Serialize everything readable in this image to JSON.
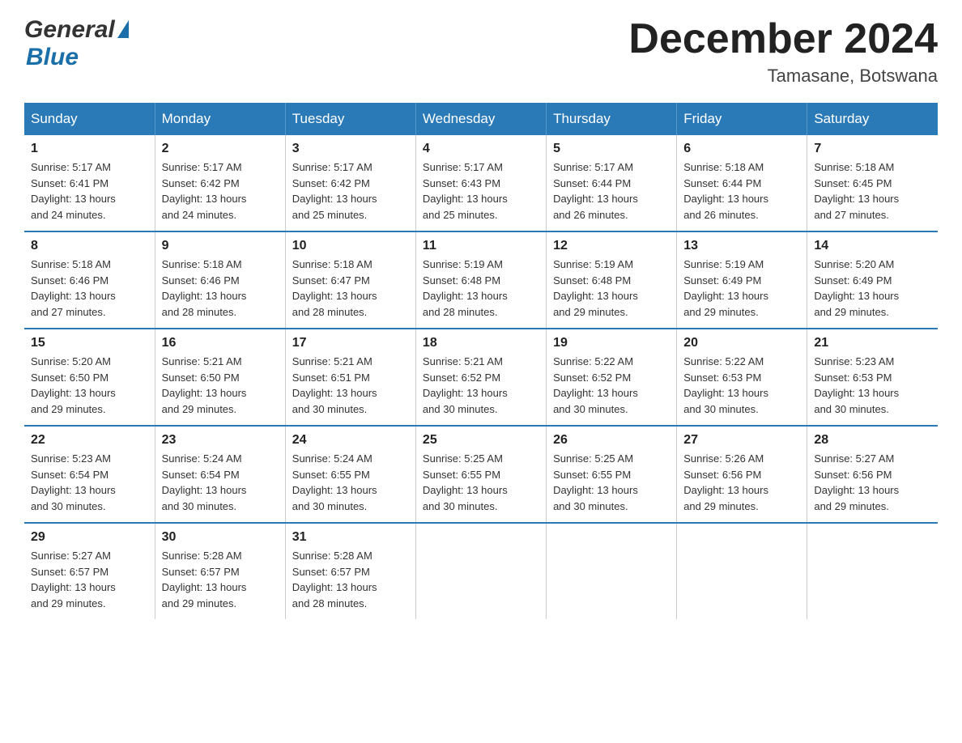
{
  "header": {
    "logo_general": "General",
    "logo_blue": "Blue",
    "month_title": "December 2024",
    "location": "Tamasane, Botswana"
  },
  "calendar": {
    "headers": [
      "Sunday",
      "Monday",
      "Tuesday",
      "Wednesday",
      "Thursday",
      "Friday",
      "Saturday"
    ],
    "weeks": [
      [
        {
          "day": "1",
          "sunrise": "5:17 AM",
          "sunset": "6:41 PM",
          "daylight": "13 hours and 24 minutes."
        },
        {
          "day": "2",
          "sunrise": "5:17 AM",
          "sunset": "6:42 PM",
          "daylight": "13 hours and 24 minutes."
        },
        {
          "day": "3",
          "sunrise": "5:17 AM",
          "sunset": "6:42 PM",
          "daylight": "13 hours and 25 minutes."
        },
        {
          "day": "4",
          "sunrise": "5:17 AM",
          "sunset": "6:43 PM",
          "daylight": "13 hours and 25 minutes."
        },
        {
          "day": "5",
          "sunrise": "5:17 AM",
          "sunset": "6:44 PM",
          "daylight": "13 hours and 26 minutes."
        },
        {
          "day": "6",
          "sunrise": "5:18 AM",
          "sunset": "6:44 PM",
          "daylight": "13 hours and 26 minutes."
        },
        {
          "day": "7",
          "sunrise": "5:18 AM",
          "sunset": "6:45 PM",
          "daylight": "13 hours and 27 minutes."
        }
      ],
      [
        {
          "day": "8",
          "sunrise": "5:18 AM",
          "sunset": "6:46 PM",
          "daylight": "13 hours and 27 minutes."
        },
        {
          "day": "9",
          "sunrise": "5:18 AM",
          "sunset": "6:46 PM",
          "daylight": "13 hours and 28 minutes."
        },
        {
          "day": "10",
          "sunrise": "5:18 AM",
          "sunset": "6:47 PM",
          "daylight": "13 hours and 28 minutes."
        },
        {
          "day": "11",
          "sunrise": "5:19 AM",
          "sunset": "6:48 PM",
          "daylight": "13 hours and 28 minutes."
        },
        {
          "day": "12",
          "sunrise": "5:19 AM",
          "sunset": "6:48 PM",
          "daylight": "13 hours and 29 minutes."
        },
        {
          "day": "13",
          "sunrise": "5:19 AM",
          "sunset": "6:49 PM",
          "daylight": "13 hours and 29 minutes."
        },
        {
          "day": "14",
          "sunrise": "5:20 AM",
          "sunset": "6:49 PM",
          "daylight": "13 hours and 29 minutes."
        }
      ],
      [
        {
          "day": "15",
          "sunrise": "5:20 AM",
          "sunset": "6:50 PM",
          "daylight": "13 hours and 29 minutes."
        },
        {
          "day": "16",
          "sunrise": "5:21 AM",
          "sunset": "6:50 PM",
          "daylight": "13 hours and 29 minutes."
        },
        {
          "day": "17",
          "sunrise": "5:21 AM",
          "sunset": "6:51 PM",
          "daylight": "13 hours and 30 minutes."
        },
        {
          "day": "18",
          "sunrise": "5:21 AM",
          "sunset": "6:52 PM",
          "daylight": "13 hours and 30 minutes."
        },
        {
          "day": "19",
          "sunrise": "5:22 AM",
          "sunset": "6:52 PM",
          "daylight": "13 hours and 30 minutes."
        },
        {
          "day": "20",
          "sunrise": "5:22 AM",
          "sunset": "6:53 PM",
          "daylight": "13 hours and 30 minutes."
        },
        {
          "day": "21",
          "sunrise": "5:23 AM",
          "sunset": "6:53 PM",
          "daylight": "13 hours and 30 minutes."
        }
      ],
      [
        {
          "day": "22",
          "sunrise": "5:23 AM",
          "sunset": "6:54 PM",
          "daylight": "13 hours and 30 minutes."
        },
        {
          "day": "23",
          "sunrise": "5:24 AM",
          "sunset": "6:54 PM",
          "daylight": "13 hours and 30 minutes."
        },
        {
          "day": "24",
          "sunrise": "5:24 AM",
          "sunset": "6:55 PM",
          "daylight": "13 hours and 30 minutes."
        },
        {
          "day": "25",
          "sunrise": "5:25 AM",
          "sunset": "6:55 PM",
          "daylight": "13 hours and 30 minutes."
        },
        {
          "day": "26",
          "sunrise": "5:25 AM",
          "sunset": "6:55 PM",
          "daylight": "13 hours and 30 minutes."
        },
        {
          "day": "27",
          "sunrise": "5:26 AM",
          "sunset": "6:56 PM",
          "daylight": "13 hours and 29 minutes."
        },
        {
          "day": "28",
          "sunrise": "5:27 AM",
          "sunset": "6:56 PM",
          "daylight": "13 hours and 29 minutes."
        }
      ],
      [
        {
          "day": "29",
          "sunrise": "5:27 AM",
          "sunset": "6:57 PM",
          "daylight": "13 hours and 29 minutes."
        },
        {
          "day": "30",
          "sunrise": "5:28 AM",
          "sunset": "6:57 PM",
          "daylight": "13 hours and 29 minutes."
        },
        {
          "day": "31",
          "sunrise": "5:28 AM",
          "sunset": "6:57 PM",
          "daylight": "13 hours and 28 minutes."
        },
        null,
        null,
        null,
        null
      ]
    ],
    "labels": {
      "sunrise": "Sunrise:",
      "sunset": "Sunset:",
      "daylight": "Daylight:"
    }
  }
}
